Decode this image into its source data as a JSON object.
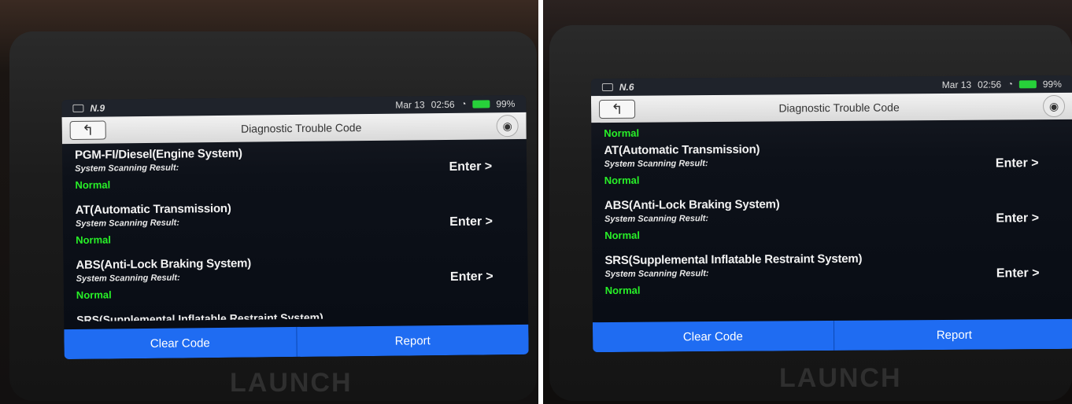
{
  "left": {
    "statusbar": {
      "left_text": "N.9",
      "date": "Mar 13",
      "time": "02:56",
      "battery": "99%"
    },
    "titlebar": {
      "title": "Diagnostic Trouble Code",
      "back_icon": "back-icon",
      "camera_icon": "camera-icon"
    },
    "items": [
      {
        "system": "PGM-FI/Diesel(Engine System)",
        "scan_label": "System Scanning Result:",
        "result": "Normal",
        "enter": "Enter >"
      },
      {
        "system": "AT(Automatic Transmission)",
        "scan_label": "System Scanning Result:",
        "result": "Normal",
        "enter": "Enter >"
      },
      {
        "system": "ABS(Anti-Lock Braking System)",
        "scan_label": "System Scanning Result:",
        "result": "Normal",
        "enter": "Enter >"
      }
    ],
    "partial_item": "SRS(Supplemental Inflatable Restraint System)",
    "buttons": {
      "clear": "Clear Code",
      "report": "Report"
    },
    "brand": "LAUNCH"
  },
  "right": {
    "statusbar": {
      "left_text": "N.6",
      "date": "Mar 13",
      "time": "02:56",
      "battery": "99%"
    },
    "titlebar": {
      "title": "Diagnostic Trouble Code",
      "back_icon": "back-icon",
      "camera_icon": "camera-icon"
    },
    "top_partial": "Normal",
    "items": [
      {
        "system": "AT(Automatic Transmission)",
        "scan_label": "System Scanning Result:",
        "result": "Normal",
        "enter": "Enter >"
      },
      {
        "system": "ABS(Anti-Lock Braking System)",
        "scan_label": "System Scanning Result:",
        "result": "Normal",
        "enter": "Enter >"
      },
      {
        "system": "SRS(Supplemental Inflatable Restraint System)",
        "scan_label": "System Scanning Result:",
        "result": "Normal",
        "enter": "Enter >"
      }
    ],
    "buttons": {
      "clear": "Clear Code",
      "report": "Report"
    },
    "brand": "LAUNCH"
  }
}
